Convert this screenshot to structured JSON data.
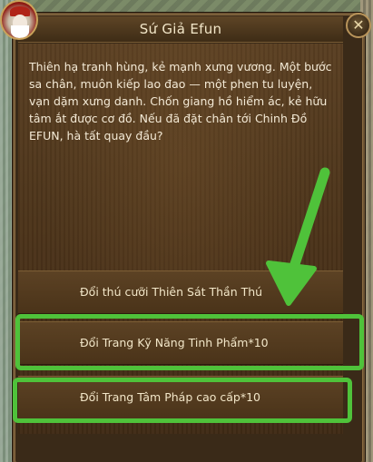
{
  "dialog": {
    "title": "Sứ Giả Efun",
    "close_symbol": "✕",
    "message": "Thiên hạ tranh hùng, kẻ mạnh xưng vương. Một bước sa chân, muôn kiếp lao đao — một phen tu luyện, vạn dặm xưng danh. Chốn giang hồ hiểm ác, kẻ hữu tâm ắt được cơ đồ. Nếu đã đặt chân tới Chinh Đồ EFUN, hà tất quay đầu?"
  },
  "options": [
    {
      "label": "Đổi thú cưỡi Thiên Sát Thần Thú"
    },
    {
      "label": "Đổi Trang Kỹ Năng Tinh Phẩm*10"
    },
    {
      "label": "Đổi Trang Tâm Pháp cao cấp*10"
    }
  ],
  "annotation": {
    "highlight_color": "#4fc23a",
    "arrow_color": "#4fc23a"
  },
  "icons": {
    "avatar": "sage-avatar-icon",
    "close": "close-icon",
    "arrow": "arrow-down-left-icon"
  }
}
